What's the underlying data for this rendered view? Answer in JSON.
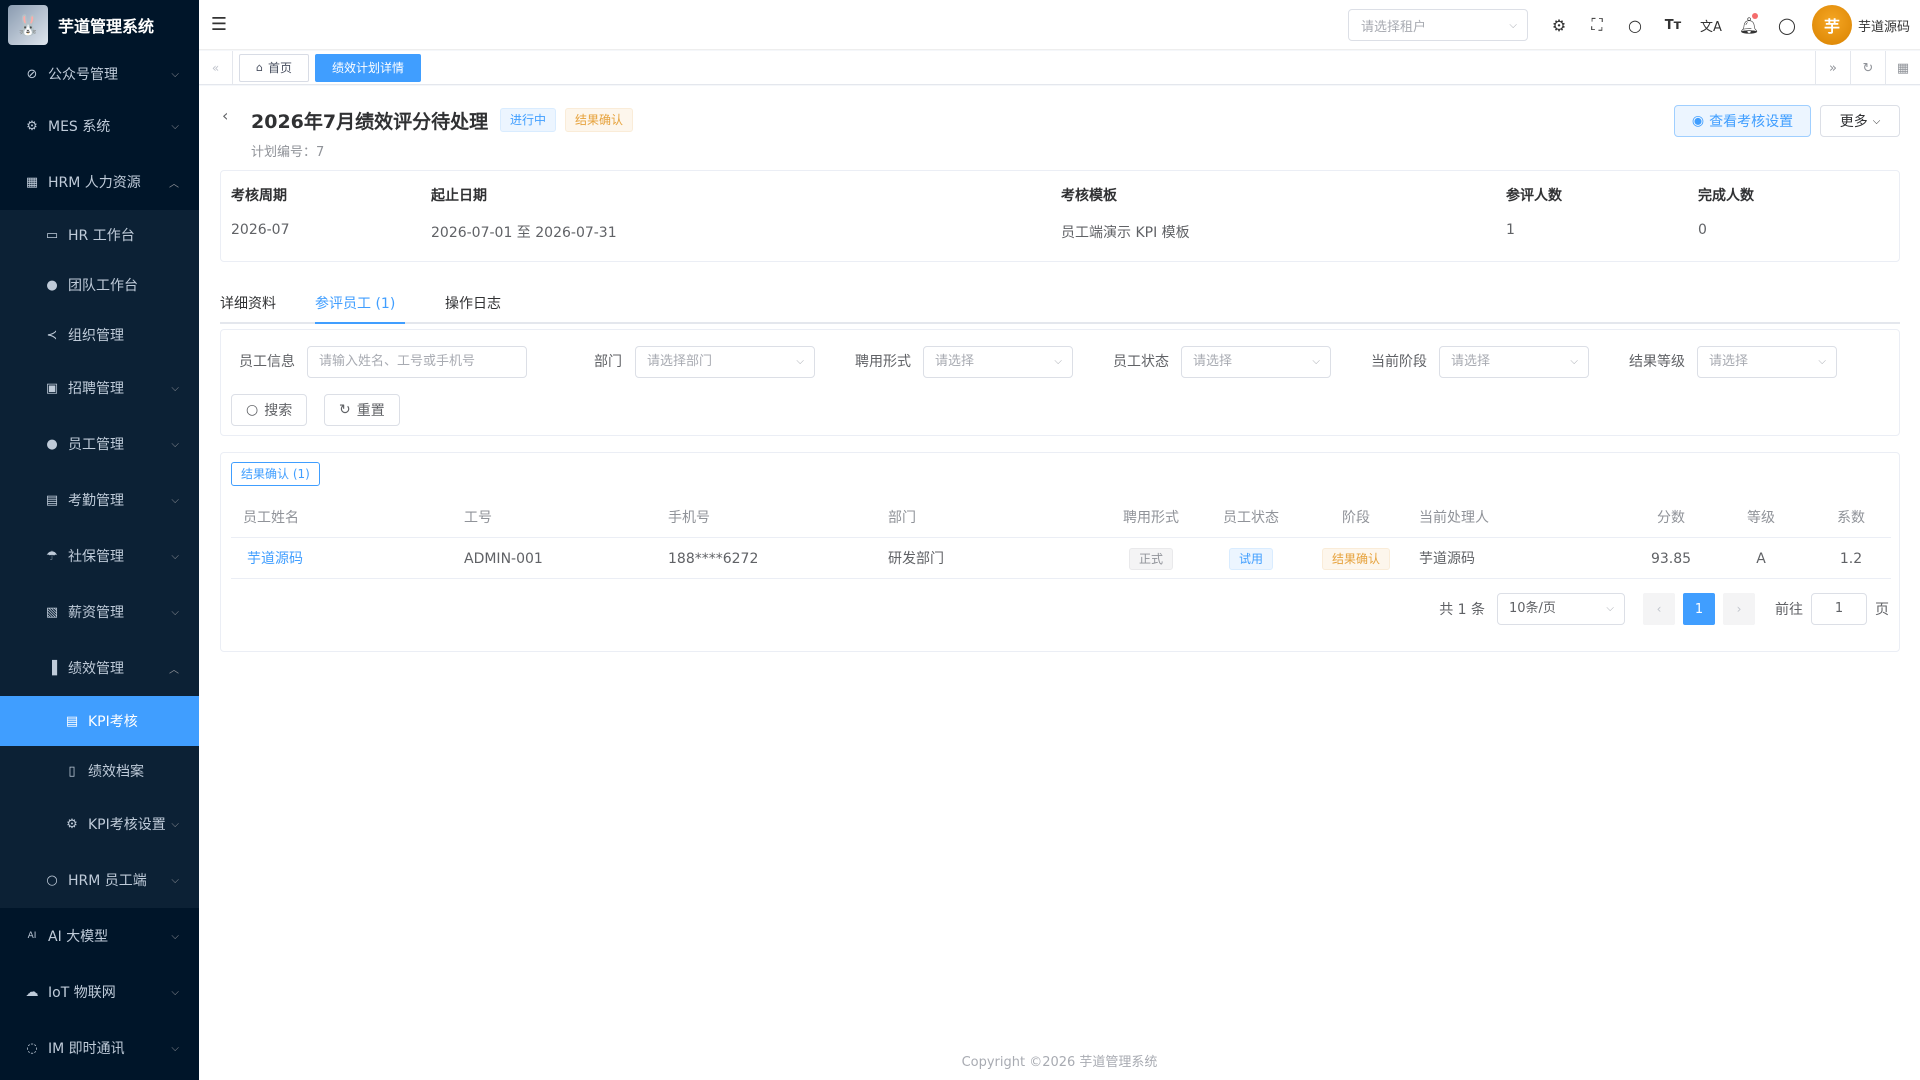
{
  "app": {
    "title": "芋道管理系统"
  },
  "sidebar": {
    "items": [
      {
        "label": "公众号管理"
      },
      {
        "label": "MES 系统"
      },
      {
        "label": "HRM 人力资源"
      },
      {
        "label": "AI 大模型"
      },
      {
        "label": "IoT 物联网"
      },
      {
        "label": "IM 即时通讯"
      }
    ],
    "hrm": [
      {
        "label": "HR 工作台"
      },
      {
        "label": "团队工作台"
      },
      {
        "label": "组织管理"
      },
      {
        "label": "招聘管理"
      },
      {
        "label": "员工管理"
      },
      {
        "label": "考勤管理"
      },
      {
        "label": "社保管理"
      },
      {
        "label": "薪资管理"
      },
      {
        "label": "绩效管理"
      },
      {
        "label": "HRM 员工端"
      }
    ],
    "perf": [
      {
        "label": "KPI考核"
      },
      {
        "label": "绩效档案"
      },
      {
        "label": "KPI考核设置"
      }
    ]
  },
  "header": {
    "tenant_placeholder": "请选择租户",
    "user_name": "芋道源码",
    "avatar_text": "芋"
  },
  "tags": {
    "home": "首页",
    "current": "绩效计划详情"
  },
  "page": {
    "title": "2026年7月绩效评分待处理",
    "status1": "进行中",
    "status2": "结果确认",
    "plan_no": "计划编号：7",
    "btn_settings": "查看考核设置",
    "btn_more": "更多"
  },
  "info": {
    "period_label": "考核周期",
    "period_value": "2026-07",
    "range_label": "起止日期",
    "range_value": "2026-07-01 至 2026-07-31",
    "template_label": "考核模板",
    "template_value": "员工端演示 KPI 模板",
    "participants_label": "参评人数",
    "participants_value": "1",
    "done_label": "完成人数",
    "done_value": "0"
  },
  "tabs": [
    {
      "label": "详细资料"
    },
    {
      "label": "参评员工 (1)"
    },
    {
      "label": "操作日志"
    }
  ],
  "filters": {
    "employee_label": "员工信息",
    "employee_placeholder": "请输入姓名、工号或手机号",
    "dept_label": "部门",
    "dept_placeholder": "请选择部门",
    "hire_label": "聘用形式",
    "hire_placeholder": "请选择",
    "status_label": "员工状态",
    "status_placeholder": "请选择",
    "stage_label": "当前阶段",
    "stage_placeholder": "请选择",
    "grade_label": "结果等级",
    "grade_placeholder": "请选择",
    "search_btn": "搜索",
    "reset_btn": "重置"
  },
  "table": {
    "group_tag": "结果确认 (1)",
    "columns": [
      "员工姓名",
      "工号",
      "手机号",
      "部门",
      "聘用形式",
      "员工状态",
      "阶段",
      "当前处理人",
      "分数",
      "等级",
      "系数"
    ],
    "rows": [
      [
        "芋道源码",
        "ADMIN-001",
        "188****6272",
        "研发部门",
        "正式",
        "试用",
        "结果确认",
        "芋道源码",
        "93.85",
        "A",
        "1.2"
      ]
    ]
  },
  "pagination": {
    "total": "共 1 条",
    "page_size": "10条/页",
    "current_page": "1",
    "goto_label": "前往",
    "goto_value": "1",
    "page_suffix": "页"
  },
  "footer": {
    "text": "Copyright ©2026 芋道管理系统"
  }
}
